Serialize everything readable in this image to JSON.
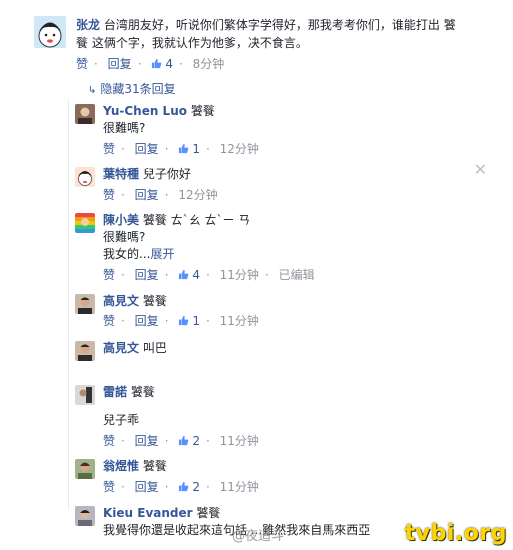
{
  "post": {
    "author": "张龙",
    "text_line1": "台湾朋友好，听说你们繁体字学得好，那我考考你们，谁能打出 饕",
    "text_line2": "餮 这俩个字，我就认作为他爹，决不食言。",
    "actions": {
      "like": "赞",
      "reply": "回复",
      "likes": "4",
      "time": "8分钟"
    }
  },
  "hidden_replies_label": "隐藏31条回复",
  "replies": [
    {
      "author": "Yu-Chen Luo",
      "line1": "饕餮",
      "line2": "很難嗎?",
      "like": "赞",
      "reply": "回复",
      "likes": "1",
      "time": "12分钟"
    },
    {
      "author": "葉特種",
      "line1": "兒子你好",
      "like": "赞",
      "reply": "回复",
      "time": "12分钟"
    },
    {
      "author": "陳小美",
      "line1": "饕餮 ㄊˋㄠ ㄊˋㄧ ㄢ",
      "line2": "很難嗎?",
      "line3_prefix": "我女的...",
      "line3_link": "展开",
      "like": "赞",
      "reply": "回复",
      "likes": "4",
      "time": "11分钟",
      "edited": "已编辑"
    },
    {
      "author": "高見文",
      "line1": "饕餮",
      "like": "赞",
      "reply": "回复",
      "likes": "1",
      "time": "11分钟"
    },
    {
      "author": "高見文",
      "line1": "叫巴"
    },
    {
      "author": "雷諾",
      "line1": "饕餮",
      "line2": "兒子乖",
      "like": "赞",
      "reply": "回复",
      "likes": "2",
      "time": "11分钟"
    },
    {
      "author": "翁煜惟",
      "line1": "饕餮",
      "like": "赞",
      "reply": "回复",
      "likes": "2",
      "time": "11分钟"
    },
    {
      "author": "Kieu Evander",
      "line1": "饕餮",
      "line2": "我覺得你還是收起來這句話 ...雖然我來自馬來西亞"
    }
  ],
  "watermark": "tvbi.org",
  "weibo_mark": "@夜追斗",
  "colors": {
    "name": "#365899",
    "meta": "#90949c",
    "watermark": "#ffd400"
  }
}
